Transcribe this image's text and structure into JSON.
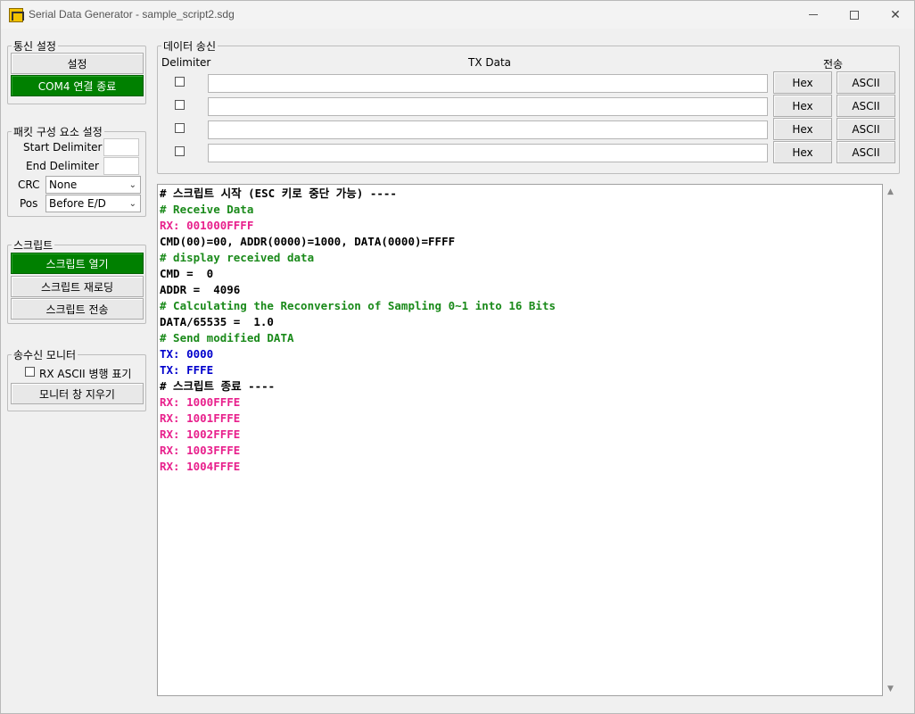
{
  "window": {
    "title": "Serial Data Generator - sample_script2.sdg"
  },
  "comm": {
    "legend": "통신 설정",
    "settings_label": "설정",
    "connect_label": "COM4 연결 종료"
  },
  "packet": {
    "legend": "패킷 구성 요소 설정",
    "start_label": "Start Delimiter",
    "end_label": "End Delimiter",
    "crc_label": "CRC",
    "crc_value": "None",
    "pos_label": "Pos",
    "pos_value": "Before E/D"
  },
  "script": {
    "legend": "스크립트",
    "open_label": "스크립트 열기",
    "reload_label": "스크립트 재로딩",
    "send_label": "스크립트 전송"
  },
  "monitor": {
    "legend": "송수신 모니터",
    "rx_ascii_label": "RX ASCII 병행 표기",
    "clear_label": "모니터 창 지우기"
  },
  "tx": {
    "legend": "데이터 송신",
    "delimiter_header": "Delimiter",
    "data_header": "TX Data",
    "send_header": "전송",
    "rows": [
      {
        "hex": "Hex",
        "ascii": "ASCII",
        "value": ""
      },
      {
        "hex": "Hex",
        "ascii": "ASCII",
        "value": ""
      },
      {
        "hex": "Hex",
        "ascii": "ASCII",
        "value": ""
      },
      {
        "hex": "Hex",
        "ascii": "ASCII",
        "value": ""
      }
    ]
  },
  "colors": {
    "black": "#000000",
    "comment": "#1a8a1a",
    "rx": "#e8208c",
    "tx": "#0000cc"
  },
  "console": {
    "lines": [
      {
        "text": "# 스크립트 시작 (ESC 키로 중단 가능) ----",
        "kind": "black"
      },
      {
        "text": "# Receive Data",
        "kind": "comment"
      },
      {
        "text": "RX: 001000FFFF",
        "kind": "rx"
      },
      {
        "text": "CMD(00)=00, ADDR(0000)=1000, DATA(0000)=FFFF",
        "kind": "black"
      },
      {
        "text": "# display received data",
        "kind": "comment"
      },
      {
        "text": "CMD =  0",
        "kind": "black"
      },
      {
        "text": "ADDR =  4096",
        "kind": "black"
      },
      {
        "text": "# Calculating the Reconversion of Sampling 0~1 into 16 Bits",
        "kind": "comment"
      },
      {
        "text": "DATA/65535 =  1.0",
        "kind": "black"
      },
      {
        "text": "# Send modified DATA",
        "kind": "comment"
      },
      {
        "text": "TX: 0000",
        "kind": "tx"
      },
      {
        "text": "TX: FFFE",
        "kind": "tx"
      },
      {
        "text": "# 스크립트 종료 ----",
        "kind": "black"
      },
      {
        "text": "RX: 1000FFFE",
        "kind": "rx"
      },
      {
        "text": "RX: 1001FFFE",
        "kind": "rx"
      },
      {
        "text": "RX: 1002FFFE",
        "kind": "rx"
      },
      {
        "text": "RX: 1003FFFE",
        "kind": "rx"
      },
      {
        "text": "RX: 1004FFFE",
        "kind": "rx"
      }
    ]
  }
}
